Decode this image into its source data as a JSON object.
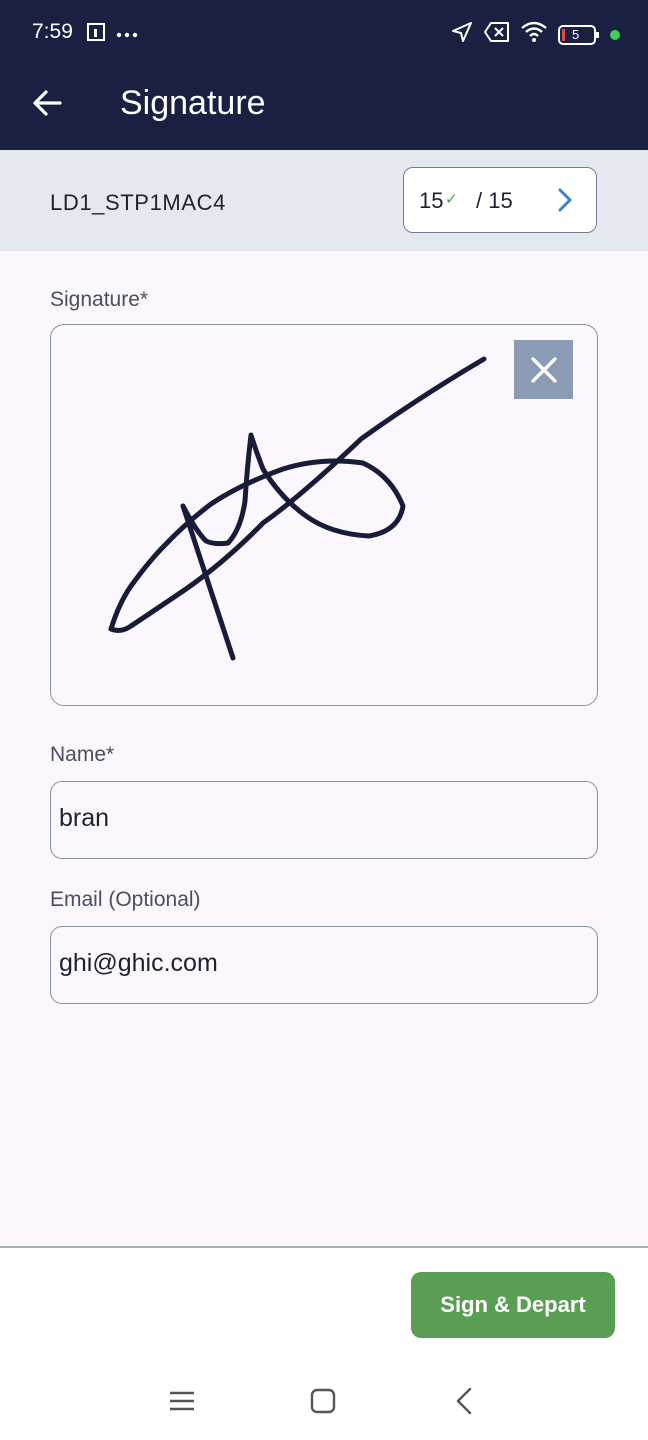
{
  "status_bar": {
    "time": "7:59",
    "left_icons": [
      "calendar-icon",
      "more-dots-icon"
    ],
    "right_icons": [
      "navigation-icon",
      "no-sim-icon",
      "wifi-icon",
      "battery-icon"
    ],
    "battery_level": "5",
    "dot_color": "#3ecf5c"
  },
  "app_bar": {
    "title": "Signature",
    "background": "#192041"
  },
  "stop": {
    "id": "LD1_STP1MAC4",
    "completed": "15",
    "total": "/ 15"
  },
  "form": {
    "signature_label": "Signature*",
    "name_label": "Name*",
    "name_value": "bran",
    "email_label": "Email (Optional)",
    "email_value": "ghi@ghic.com"
  },
  "footer": {
    "sign_depart_label": "Sign & Depart",
    "button_color": "#5a9e56"
  },
  "nav_bar": {
    "buttons": [
      "menu-icon",
      "home-icon",
      "back-icon"
    ]
  }
}
